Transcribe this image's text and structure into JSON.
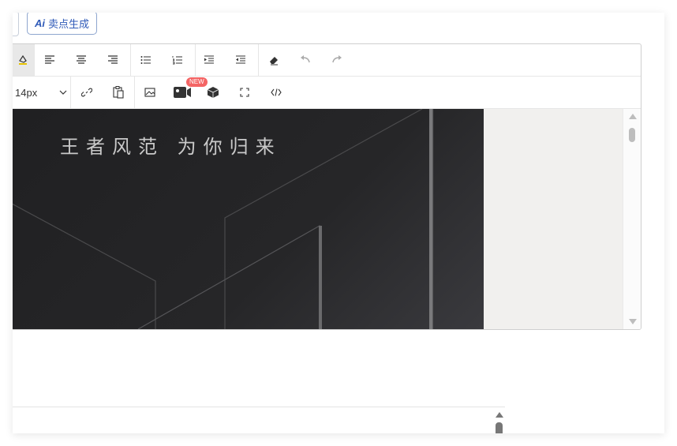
{
  "header": {
    "ai_button_label": "卖点生成",
    "ai_mark": "Ai"
  },
  "toolbar": {
    "row1": [
      {
        "icon": "highlight-color-icon"
      },
      {
        "icon": "align-left-icon"
      },
      {
        "icon": "align-center-icon"
      },
      {
        "icon": "align-right-icon"
      },
      {
        "icon": "bullet-list-icon"
      },
      {
        "icon": "numbered-list-icon"
      },
      {
        "icon": "indent-icon"
      },
      {
        "icon": "outdent-icon"
      },
      {
        "icon": "eraser-icon"
      },
      {
        "icon": "undo-icon"
      },
      {
        "icon": "redo-icon"
      }
    ],
    "row2": {
      "font_size": "14px",
      "new_badge": "NEW",
      "icons": [
        "link-icon",
        "paste-icon",
        "image-icon",
        "video-icon",
        "3d-model-icon",
        "fullscreen-icon",
        "code-view-icon"
      ]
    }
  },
  "content": {
    "banner_title": "王者风范  为你归来"
  },
  "colors": {
    "accent": "#2f5ab8",
    "badge": "#f46464",
    "banner_bg": "#232325"
  }
}
